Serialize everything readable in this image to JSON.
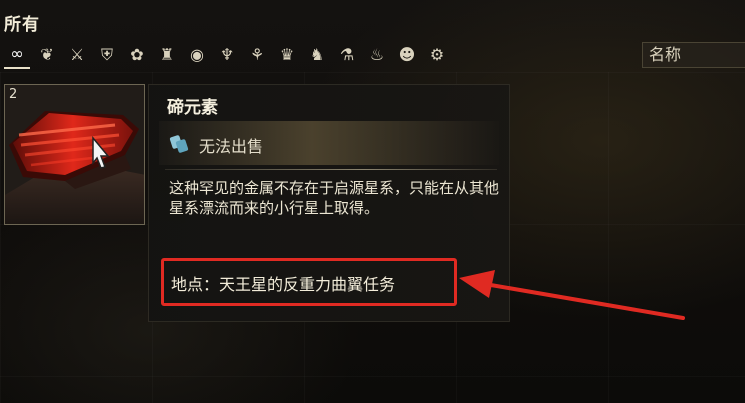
{
  "header": {
    "category": "所有",
    "sort_label": "名称"
  },
  "filters": [
    {
      "icon": "infinity-icon",
      "glyph": "∞",
      "active": true
    },
    {
      "icon": "wing-icon",
      "glyph": "❦"
    },
    {
      "icon": "sword-icon",
      "glyph": "⚔"
    },
    {
      "icon": "armor-icon",
      "glyph": "⛨"
    },
    {
      "icon": "cluster-icon",
      "glyph": "✿"
    },
    {
      "icon": "helmet-icon",
      "glyph": "♜"
    },
    {
      "icon": "target-icon",
      "glyph": "◉"
    },
    {
      "icon": "torch-icon",
      "glyph": "♆"
    },
    {
      "icon": "tripod-icon",
      "glyph": "⚘"
    },
    {
      "icon": "mask-icon",
      "glyph": "♛"
    },
    {
      "icon": "claw-icon",
      "glyph": "♞"
    },
    {
      "icon": "bottle-icon",
      "glyph": "⚗"
    },
    {
      "icon": "potion-icon",
      "glyph": "♨"
    },
    {
      "icon": "face-icon",
      "glyph": "☻"
    },
    {
      "icon": "relic-icon",
      "glyph": "⚙"
    }
  ],
  "item": {
    "count": "2",
    "name": "碲元素",
    "sell_status": "无法出售",
    "description": "这种罕见的金属不存在于启源星系，只能在从其他星系漂流而来的小行星上取得。",
    "location": "地点：天王星的反重力曲翼任务"
  },
  "colors": {
    "highlight_red": "#e02a22",
    "text": "#ece6d3"
  }
}
